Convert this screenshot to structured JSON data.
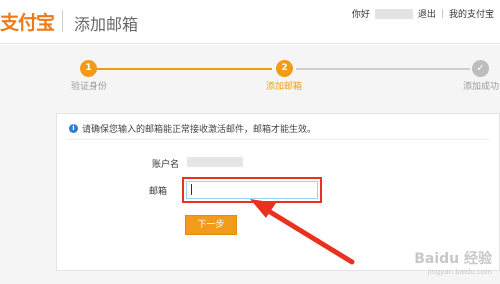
{
  "header": {
    "logo_text": "支付宝",
    "page_title": "添加邮箱",
    "greeting": "你好",
    "logout_label": "退出",
    "separator": "|",
    "my_alipay_label": "我的支付宝"
  },
  "steps": [
    {
      "number": "1",
      "label": "验证身份",
      "state": "done"
    },
    {
      "number": "2",
      "label": "添加邮箱",
      "state": "current"
    },
    {
      "number": "✓",
      "label": "添加成功",
      "state": "todo"
    }
  ],
  "notice": {
    "text": "请确保您输入的邮箱能正常接收激活邮件，邮箱才能生效。",
    "icon": "info-icon"
  },
  "form": {
    "account_label": "账户名",
    "email_label": "邮箱",
    "email_value": "",
    "next_button_label": "下一步"
  },
  "watermark": {
    "main": "Baidu 经验",
    "sub": "jingyan.baidu.com"
  },
  "colors": {
    "accent": "#f29b1b",
    "highlight": "#e8321f",
    "info": "#2f7dd1"
  }
}
